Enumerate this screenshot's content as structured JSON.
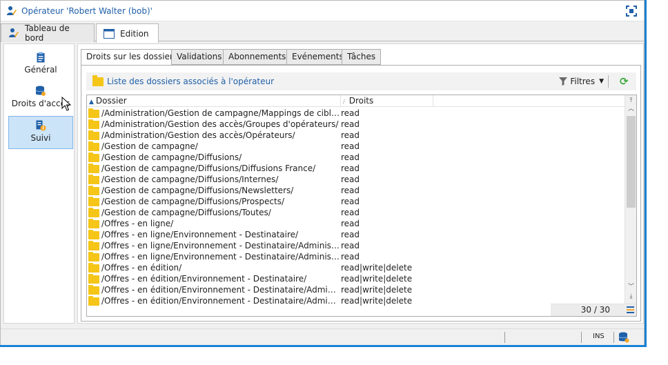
{
  "window": {
    "title": "Opérateur 'Robert Walter (bob)'",
    "colors": {
      "link": "#1f5fa8",
      "accent": "#1a82d4",
      "folder": "#f5c518",
      "refresh": "#3ca83c",
      "selection": "#cce4f7"
    }
  },
  "main_tabs": [
    {
      "label": "Tableau de bord",
      "icon": "operator-icon",
      "active": false
    },
    {
      "label": "Edition",
      "icon": "form-window-icon",
      "active": true
    }
  ],
  "sidebar": {
    "items": [
      {
        "label": "Général",
        "icon": "clipboard-icon",
        "active": false
      },
      {
        "label": "Droits d'accès",
        "icon": "database-key-icon",
        "active": false
      },
      {
        "label": "Suivi",
        "icon": "tracking-info-icon",
        "active": true
      }
    ]
  },
  "sub_tabs": [
    {
      "label": "Droits sur les dossiers",
      "active": true
    },
    {
      "label": "Validations",
      "active": false
    },
    {
      "label": "Abonnements",
      "active": false
    },
    {
      "label": "Evénements",
      "active": false
    },
    {
      "label": "Tâches",
      "active": false
    }
  ],
  "list": {
    "title": "Liste des dossiers associés à l'opérateur",
    "filters_label": "Filtres",
    "columns": {
      "folder": "Dossier",
      "rights": "Droits"
    },
    "rows": [
      {
        "folder": "/Administration/Gestion de campagne/Mappings de ciblage/",
        "rights": "read"
      },
      {
        "folder": "/Administration/Gestion des accès/Groupes d'opérateurs/",
        "rights": "read"
      },
      {
        "folder": "/Administration/Gestion des accès/Opérateurs/",
        "rights": "read"
      },
      {
        "folder": "/Gestion de campagne/",
        "rights": "read"
      },
      {
        "folder": "/Gestion de campagne/Diffusions/",
        "rights": "read"
      },
      {
        "folder": "/Gestion de campagne/Diffusions/Diffusions France/",
        "rights": "read"
      },
      {
        "folder": "/Gestion de campagne/Diffusions/Internes/",
        "rights": "read"
      },
      {
        "folder": "/Gestion de campagne/Diffusions/Newsletters/",
        "rights": "read"
      },
      {
        "folder": "/Gestion de campagne/Diffusions/Prospects/",
        "rights": "read"
      },
      {
        "folder": "/Gestion de campagne/Diffusions/Toutes/",
        "rights": "read"
      },
      {
        "folder": "/Offres - en ligne/",
        "rights": "read"
      },
      {
        "folder": "/Offres - en ligne/Environnement - Destinataire/",
        "rights": "read"
      },
      {
        "folder": "/Offres - en ligne/Environnement - Destinataire/Administration/",
        "rights": "read"
      },
      {
        "folder": "/Offres - en ligne/Environnement - Destinataire/Administration/...",
        "rights": "read"
      },
      {
        "folder": "/Offres - en édition/",
        "rights": "read|write|delete"
      },
      {
        "folder": "/Offres - en édition/Environnement - Destinataire/",
        "rights": "read|write|delete"
      },
      {
        "folder": "/Offres - en édition/Environnement - Destinataire/Administrati...",
        "rights": "read|write|delete"
      },
      {
        "folder": "/Offres - en édition/Environnement - Destinataire/Administrati...",
        "rights": "read|write|delete"
      }
    ],
    "count": "30 / 30"
  },
  "statusbar": {
    "mode": "INS"
  }
}
